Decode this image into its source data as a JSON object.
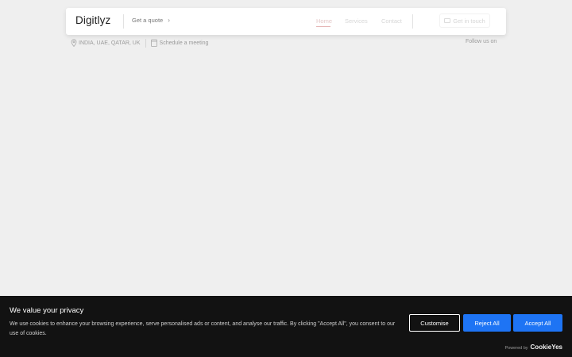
{
  "header": {
    "logo": "Digitlyz",
    "quote_label": "Get a quote",
    "chevron": "›",
    "nav": [
      {
        "label": "Home"
      },
      {
        "label": "Services"
      },
      {
        "label": "Contact"
      }
    ],
    "get_in_touch": "Get in touch"
  },
  "info": {
    "locations": "INDIA, UAE, QATAR, UK",
    "schedule": "Schedule a meeting",
    "follow": "Follow us on"
  },
  "cookie": {
    "title": "We value your privacy",
    "text": "We use cookies to enhance your browsing experience, serve personalised ads or content, and analyse our traffic. By clicking \"Accept All\", you consent to our use of cookies.",
    "customise": "Customise",
    "reject": "Reject All",
    "accept": "Accept All",
    "powered_by": "Powered by",
    "brand": "CookieYes"
  },
  "colors": {
    "accent": "#1e74f4",
    "banner_bg": "#121212",
    "page_bg": "#efefef"
  },
  "icons": [
    "location-pin-icon",
    "calendar-icon",
    "chevron-right-icon",
    "mail-icon"
  ]
}
